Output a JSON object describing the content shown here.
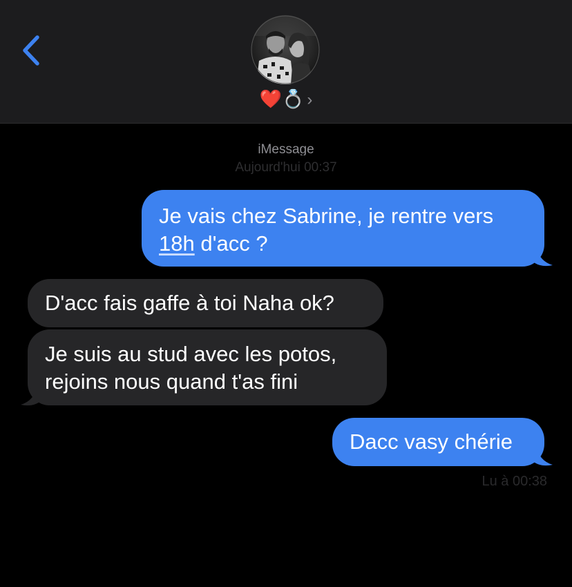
{
  "header": {
    "contact_name": "❤️💍",
    "chevron": "›",
    "icons": {
      "back": "chevron-left-icon",
      "avatar": "contact-photo"
    },
    "accent_color": "#3d82f0"
  },
  "conversation": {
    "service": "iMessage",
    "timestamp": "Aujourd'hui 00:37",
    "messages": [
      {
        "direction": "sent",
        "text_before": "Je vais chez Sabrine, je rentre vers",
        "link": "18h",
        "text_after": " d'acc ?"
      },
      {
        "direction": "received",
        "text": "D'acc fais gaffe à toi Naha ok?"
      },
      {
        "direction": "received",
        "line1": "Je suis au stud avec les potos,",
        "line2": "rejoins nous quand t'as fini"
      },
      {
        "direction": "sent",
        "text": "Dacc vasy chérie"
      }
    ],
    "read_receipt": "Lu à 00:38"
  },
  "colors": {
    "sent_bubble": "#3d82f0",
    "received_bubble": "#262628",
    "header_bg": "#1c1c1e",
    "background": "#000000"
  }
}
